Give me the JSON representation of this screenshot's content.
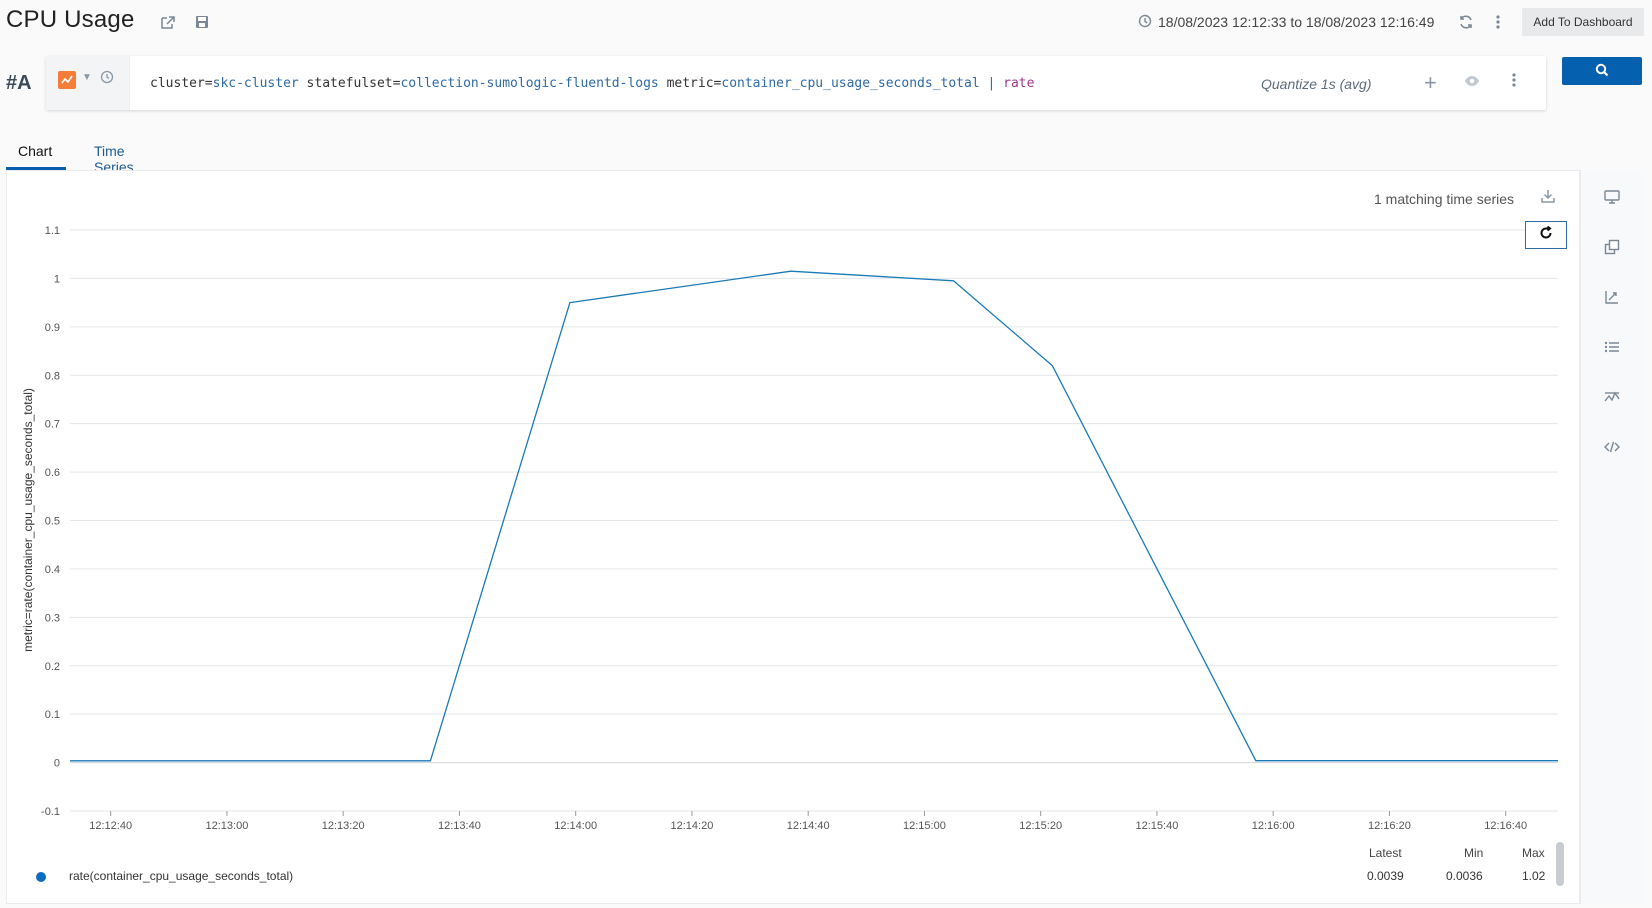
{
  "header": {
    "title": "CPU Usage",
    "time_range": "18/08/2023 12:12:33 to 18/08/2023 12:16:49",
    "add_to_dashboard": "Add To Dashboard",
    "icons": [
      "share-icon",
      "save-icon",
      "clock-icon",
      "refresh-icon",
      "more-icon"
    ]
  },
  "query": {
    "label": "#A",
    "tokens": [
      {
        "text": "cluster",
        "kind": "key"
      },
      {
        "text": "=",
        "kind": "op"
      },
      {
        "text": "skc-cluster",
        "kind": "val"
      },
      {
        "text": " statefulset",
        "kind": "key"
      },
      {
        "text": "=",
        "kind": "op"
      },
      {
        "text": "collection-sumologic-fluentd-logs",
        "kind": "val"
      },
      {
        "text": " metric",
        "kind": "key"
      },
      {
        "text": "=",
        "kind": "op"
      },
      {
        "text": "container_cpu_usage_seconds_total",
        "kind": "val"
      },
      {
        "text": " | ",
        "kind": "pipe"
      },
      {
        "text": "rate",
        "kind": "fn"
      }
    ],
    "quantize": "Quantize 1s (avg)"
  },
  "tabs": [
    {
      "label": "Chart",
      "active": true
    },
    {
      "label": "Time Series",
      "active": false
    }
  ],
  "chart": {
    "matching": "1 matching time series"
  },
  "chart_data": {
    "type": "line",
    "ylabel": "metric=rate(container_cpu_usage_seconds_total)",
    "ylim": [
      -0.1,
      1.1
    ],
    "yticks": [
      -0.1,
      0,
      0.1,
      0.2,
      0.3,
      0.4,
      0.5,
      0.6,
      0.7,
      0.8,
      0.9,
      1,
      1.1
    ],
    "ytick_labels": [
      "-0.1",
      "0",
      "0.1",
      "0.2",
      "0.3",
      "0.4",
      "0.5",
      "0.6",
      "0.7",
      "0.8",
      "0.9",
      "1",
      "1.1"
    ],
    "xlim": [
      "12:12:33",
      "12:16:49"
    ],
    "xtick_labels": [
      "12:12:40",
      "12:13:00",
      "12:13:20",
      "12:13:40",
      "12:14:00",
      "12:14:20",
      "12:14:40",
      "12:15:00",
      "12:15:20",
      "12:15:40",
      "12:16:00",
      "12:16:20",
      "12:16:40"
    ],
    "grid": true,
    "series": [
      {
        "name": "rate(container_cpu_usage_seconds_total)",
        "color": "#1a7ab8",
        "points": [
          {
            "x": "12:12:33",
            "y": 0.0036
          },
          {
            "x": "12:13:35",
            "y": 0.0036
          },
          {
            "x": "12:13:59",
            "y": 0.95
          },
          {
            "x": "12:14:37",
            "y": 1.015
          },
          {
            "x": "12:15:05",
            "y": 0.995
          },
          {
            "x": "12:15:22",
            "y": 0.82
          },
          {
            "x": "12:15:57",
            "y": 0.0039
          },
          {
            "x": "12:16:49",
            "y": 0.0039
          }
        ]
      }
    ]
  },
  "legend": {
    "headers": [
      "Latest",
      "Min",
      "Max"
    ],
    "rows": [
      {
        "name": "rate(container_cpu_usage_seconds_total)",
        "latest": "0.0039",
        "min": "0.0036",
        "max": "1.02",
        "color": "#0a6dbf"
      }
    ]
  },
  "side_rail": [
    "display-icon",
    "copy-icon",
    "axis-icon",
    "list-icon",
    "threshold-icon",
    "code-icon"
  ]
}
